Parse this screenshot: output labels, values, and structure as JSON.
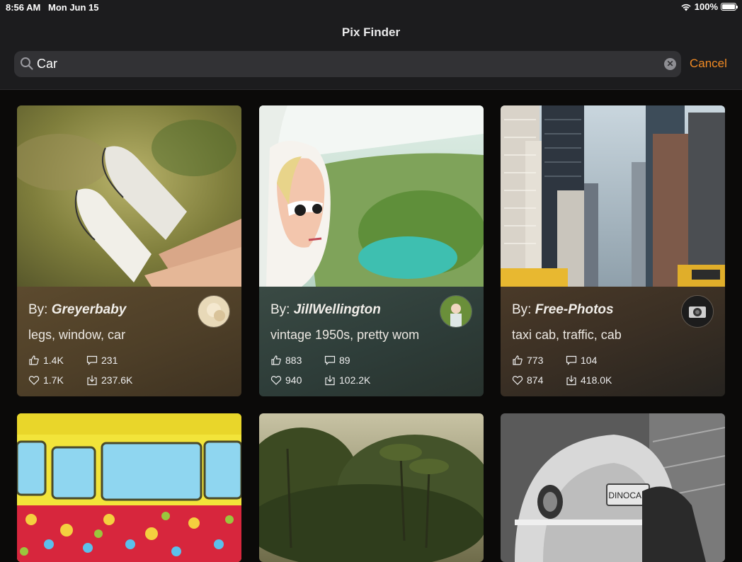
{
  "status": {
    "time": "8:56 AM",
    "date": "Mon Jun 15",
    "battery": "100%"
  },
  "nav": {
    "title": "Pix Finder"
  },
  "search": {
    "value": "Car",
    "cancel_label": "Cancel"
  },
  "cards": [
    {
      "by_prefix": "By:",
      "author": "Greyerbaby",
      "tags": "legs, window, car",
      "likes": "1.4K",
      "comments": "231",
      "favorites": "1.7K",
      "downloads": "237.6K"
    },
    {
      "by_prefix": "By:",
      "author": "JillWellington",
      "tags": "vintage 1950s, pretty wom",
      "likes": "883",
      "comments": "89",
      "favorites": "940",
      "downloads": "102.2K"
    },
    {
      "by_prefix": "By:",
      "author": "Free-Photos",
      "tags": "taxi cab, traffic, cab",
      "likes": "773",
      "comments": "104",
      "favorites": "874",
      "downloads": "418.0K"
    }
  ],
  "lower_photo_text": {
    "plate": "DINOCAR"
  },
  "colors": {
    "accent": "#f08a24",
    "background": "#0b0a09",
    "bar": "#1c1c1e"
  }
}
